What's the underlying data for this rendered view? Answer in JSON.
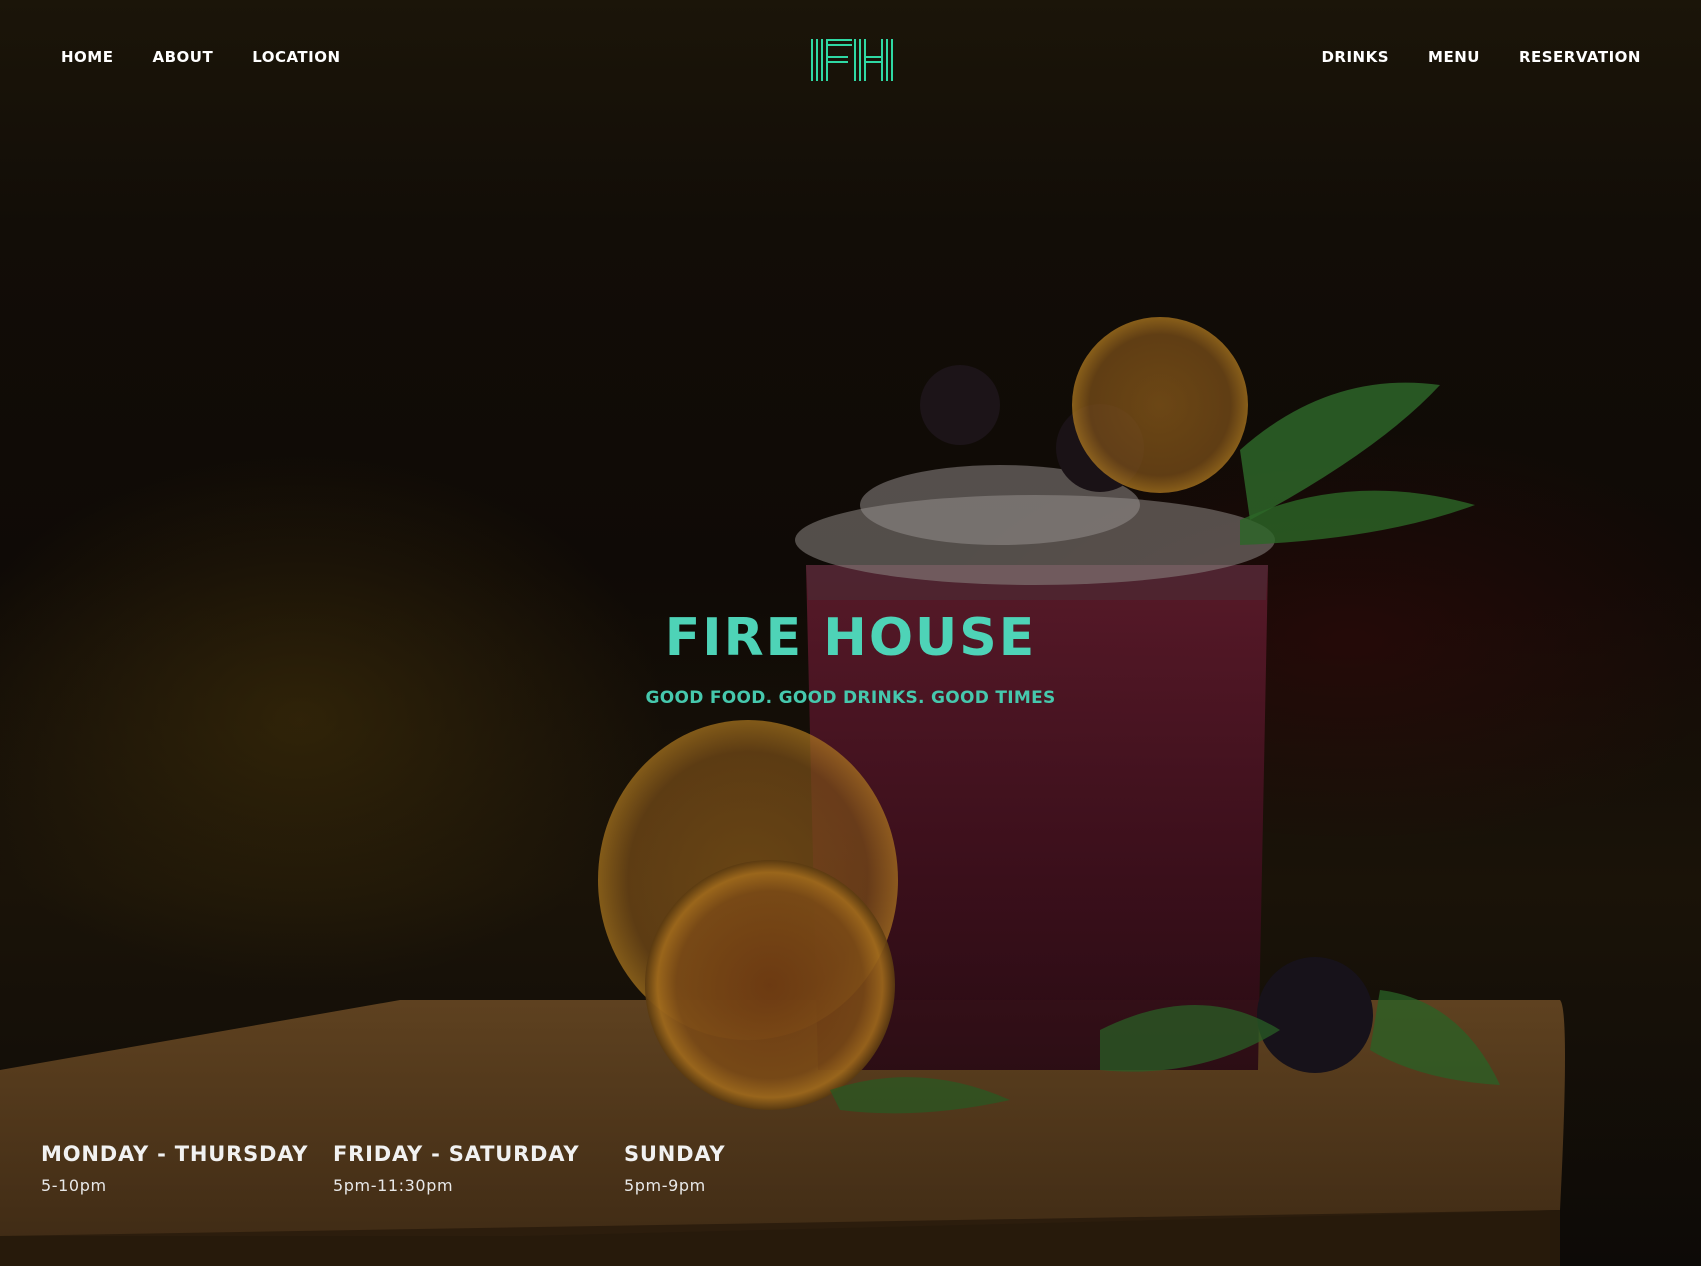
{
  "nav": {
    "left": [
      {
        "label": "HOME"
      },
      {
        "label": "ABOUT"
      },
      {
        "label": "LOCATION"
      }
    ],
    "right": [
      {
        "label": "DRINKS"
      },
      {
        "label": "MENU"
      },
      {
        "label": "RESERVATION"
      }
    ]
  },
  "logo": {
    "text": "FH",
    "icon": "fh-monogram-logo"
  },
  "hero": {
    "title": "FIRE HOUSE",
    "tagline": "GOOD FOOD. GOOD DRINKS. GOOD TIMES",
    "background": "cocktail-with-blackberries-and-dried-orange-on-wooden-board-photo"
  },
  "hours": [
    {
      "day": "MONDAY - THURSDAY",
      "time": "5-10pm"
    },
    {
      "day": "FRIDAY - SATURDAY",
      "time": "5pm-11:30pm"
    },
    {
      "day": "SUNDAY",
      "time": "5pm-9pm"
    }
  ],
  "colors": {
    "accent": "#4ed3b7",
    "accent_top": "#2fe39a",
    "accent_bottom": "#3fc9b8",
    "background": "#0c0906"
  }
}
